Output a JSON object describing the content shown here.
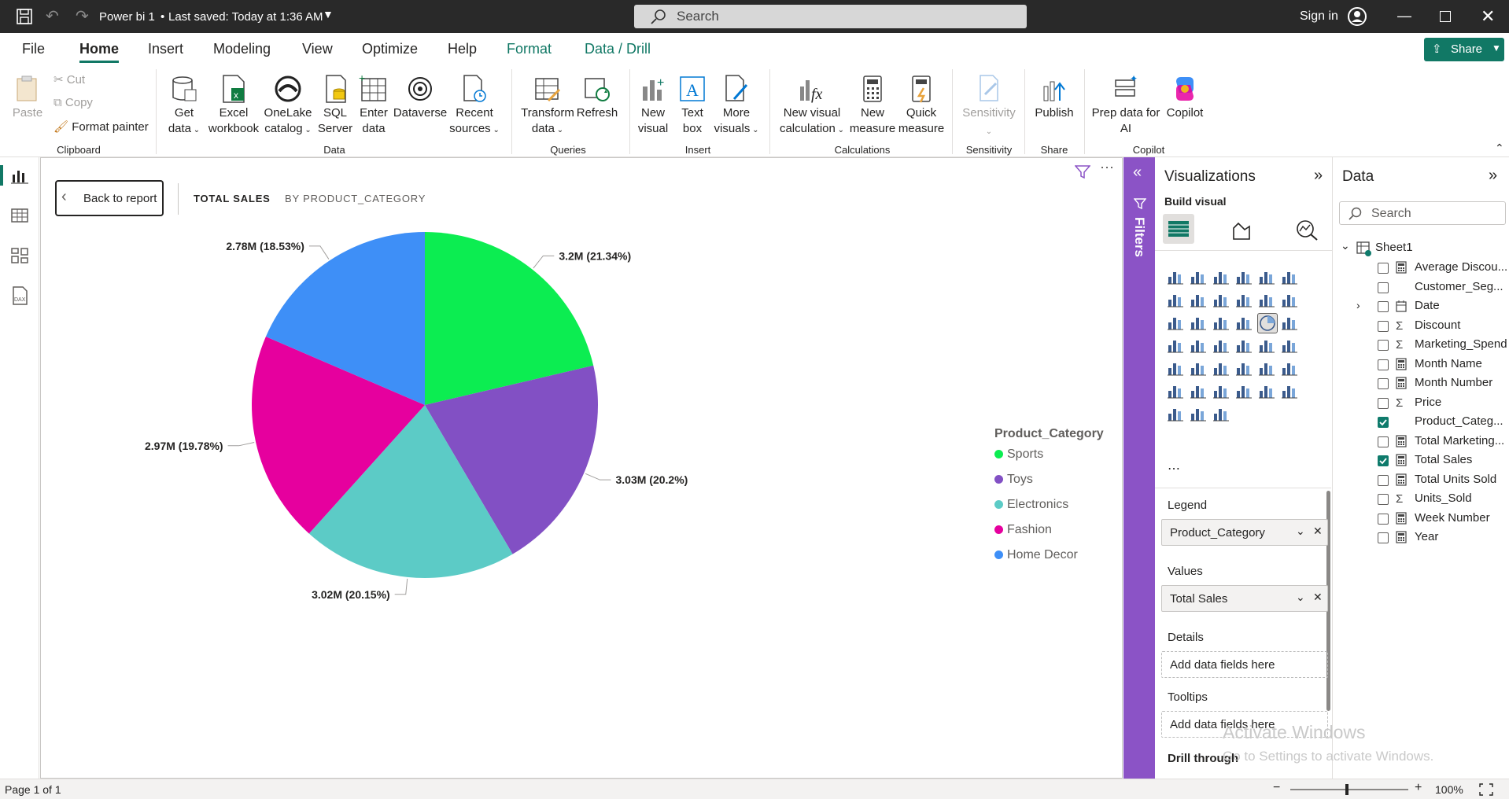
{
  "titlebar": {
    "title": "Power bi 1",
    "saved": "Last saved: Today at 1:36 AM",
    "search_placeholder": "Search",
    "signin": "Sign in"
  },
  "tabs": [
    "File",
    "Home",
    "Insert",
    "Modeling",
    "View",
    "Optimize",
    "Help",
    "Format",
    "Data / Drill"
  ],
  "share_label": "Share",
  "ribbon": {
    "clipboard": {
      "paste": "Paste",
      "cut": "Cut",
      "copy": "Copy",
      "format_painter": "Format painter",
      "group": "Clipboard"
    },
    "data": {
      "get_data": [
        "Get",
        "data"
      ],
      "excel": [
        "Excel",
        "workbook"
      ],
      "onelake": [
        "OneLake",
        "catalog"
      ],
      "sql": [
        "SQL",
        "Server"
      ],
      "enter": [
        "Enter",
        "data"
      ],
      "dataverse": "Dataverse",
      "recent": [
        "Recent",
        "sources"
      ],
      "group": "Data"
    },
    "queries": {
      "transform": [
        "Transform",
        "data"
      ],
      "refresh": "Refresh",
      "group": "Queries"
    },
    "insert": {
      "new_visual": [
        "New",
        "visual"
      ],
      "text_box": [
        "Text",
        "box"
      ],
      "more_visuals": [
        "More",
        "visuals"
      ],
      "group": "Insert"
    },
    "calculations": {
      "new_visual_calc": [
        "New visual",
        "calculation"
      ],
      "new_measure": [
        "New",
        "measure"
      ],
      "quick_measure": [
        "Quick",
        "measure"
      ],
      "group": "Calculations"
    },
    "sensitivity": {
      "label": "Sensitivity",
      "group": "Sensitivity"
    },
    "share": {
      "publish": "Publish",
      "group": "Share"
    },
    "copilot": {
      "prep": [
        "Prep data for",
        "AI"
      ],
      "copilot": "Copilot",
      "group": "Copilot"
    }
  },
  "report": {
    "back_button": "Back to report",
    "crumb_1": "TOTAL SALES",
    "crumb_2": "BY PRODUCT_CATEGORY",
    "legend_title": "Product_Category"
  },
  "chart_data": {
    "type": "pie",
    "legend_title": "Product_Category",
    "categories": [
      "Sports",
      "Toys",
      "Electronics",
      "Fashion",
      "Home Decor"
    ],
    "values": [
      3.2,
      3.03,
      3.02,
      2.97,
      2.78
    ],
    "unit": "M",
    "percents": [
      21.34,
      20.2,
      20.15,
      19.78,
      18.53
    ],
    "data_labels": [
      "3.2M (21.34%)",
      "3.03M (20.2%)",
      "3.02M (20.15%)",
      "2.97M (19.78%)",
      "2.78M (18.53%)"
    ],
    "colors": [
      "#0ced51",
      "#8250c4",
      "#5ccbc6",
      "#e6009e",
      "#3e8ff7"
    ],
    "legend_placement": "right"
  },
  "filters_label": "Filters",
  "visualizations": {
    "title": "Visualizations",
    "build_visual": "Build visual",
    "wells": [
      {
        "label": "Legend",
        "value": "Product_Category"
      },
      {
        "label": "Values",
        "value": "Total Sales"
      },
      {
        "label": "Details",
        "value": "Add data fields here"
      },
      {
        "label": "Tooltips",
        "value": "Add data fields here"
      },
      {
        "label": "Drill through",
        "value": ""
      }
    ]
  },
  "data_pane": {
    "title": "Data",
    "search_placeholder": "Search",
    "table": "Sheet1",
    "fields": [
      {
        "name": "Average Discou...",
        "type": "calc",
        "checked": false
      },
      {
        "name": "Customer_Seg...",
        "type": "",
        "checked": false
      },
      {
        "name": "Date",
        "type": "table",
        "checked": false
      },
      {
        "name": "Discount",
        "type": "sum",
        "checked": false
      },
      {
        "name": "Marketing_Spend",
        "type": "sum",
        "checked": false
      },
      {
        "name": "Month Name",
        "type": "calc",
        "checked": false
      },
      {
        "name": "Month Number",
        "type": "calc",
        "checked": false
      },
      {
        "name": "Price",
        "type": "sum",
        "checked": false
      },
      {
        "name": "Product_Categ...",
        "type": "",
        "checked": true
      },
      {
        "name": "Total Marketing...",
        "type": "calc",
        "checked": false
      },
      {
        "name": "Total Sales",
        "type": "calc",
        "checked": true
      },
      {
        "name": "Total Units Sold",
        "type": "calc",
        "checked": false
      },
      {
        "name": "Units_Sold",
        "type": "sum",
        "checked": false
      },
      {
        "name": "Week Number",
        "type": "calc",
        "checked": false
      },
      {
        "name": "Year",
        "type": "calc",
        "checked": false
      }
    ]
  },
  "watermark": {
    "line1": "Activate Windows",
    "line2": "Go to Settings to activate Windows."
  },
  "status": {
    "page": "Page 1 of 1",
    "zoom": "100%"
  }
}
